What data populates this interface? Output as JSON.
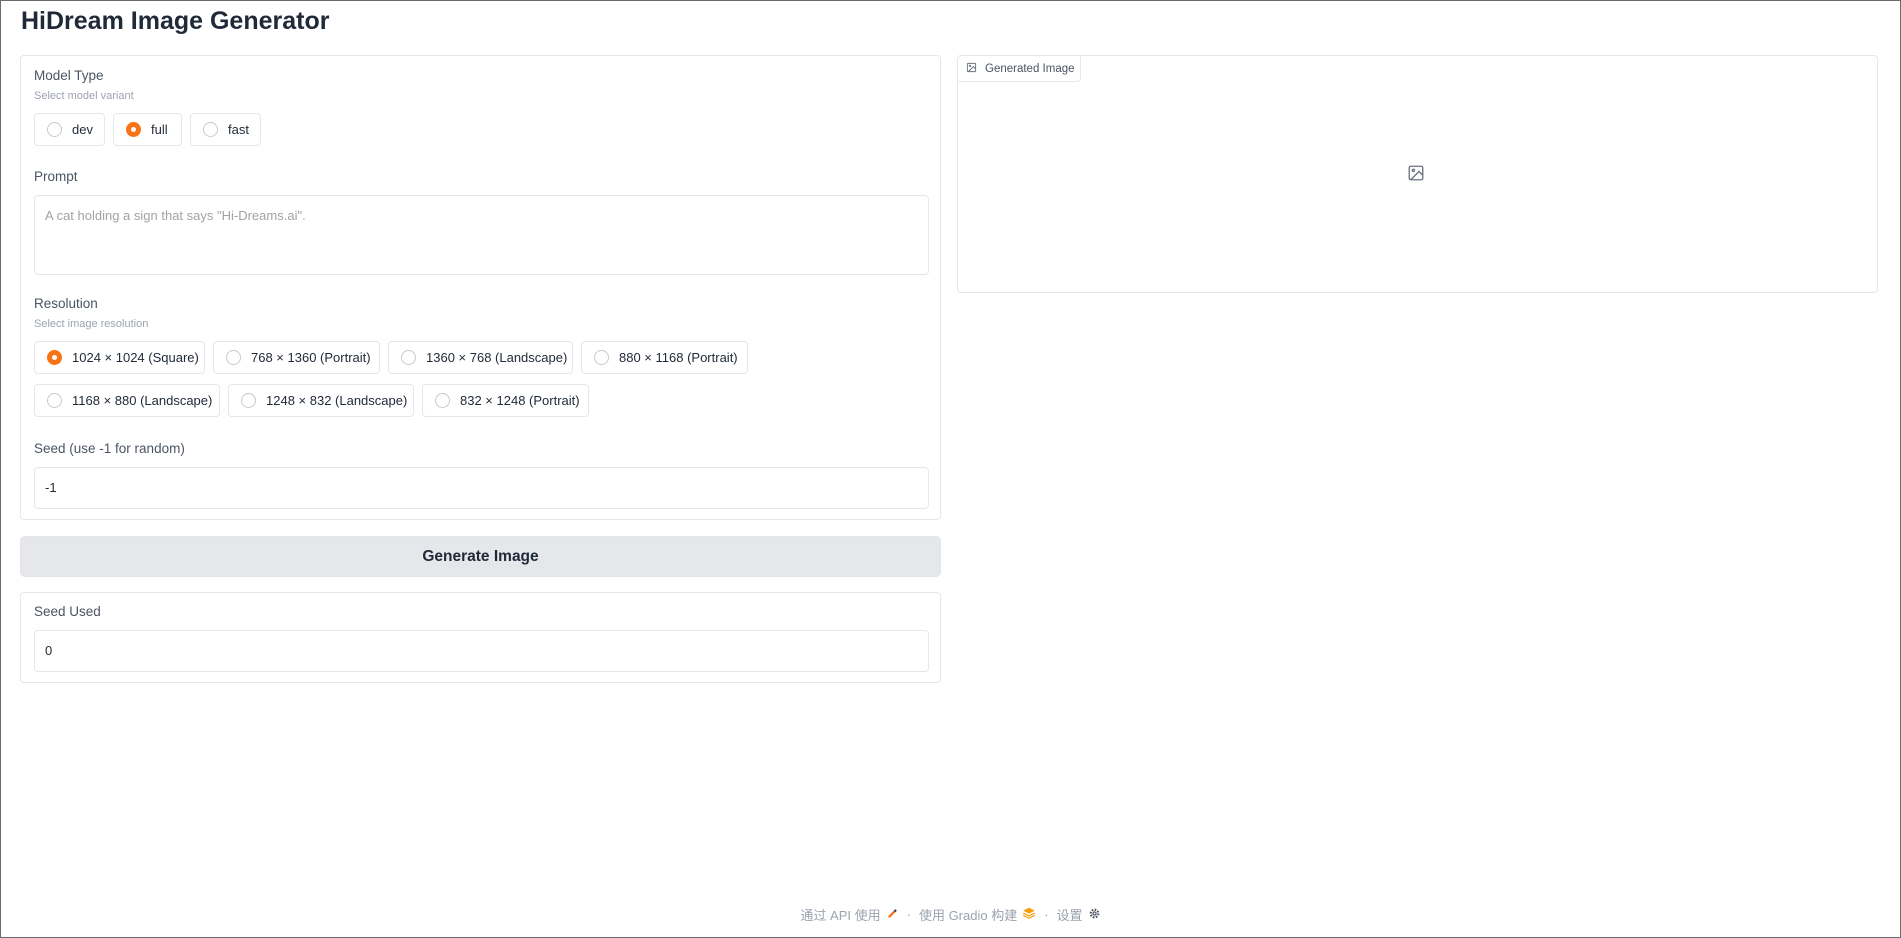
{
  "app": {
    "title": "HiDream Image Generator"
  },
  "model": {
    "label": "Model Type",
    "sublabel": "Select model variant",
    "options": [
      {
        "label": "dev",
        "selected": false
      },
      {
        "label": "full",
        "selected": true
      },
      {
        "label": "fast",
        "selected": false
      }
    ]
  },
  "prompt": {
    "label": "Prompt",
    "placeholder": "A cat holding a sign that says \"Hi-Dreams.ai\"."
  },
  "resolution": {
    "label": "Resolution",
    "sublabel": "Select image resolution",
    "options": [
      {
        "label": "1024 × 1024 (Square)",
        "selected": true
      },
      {
        "label": "768 × 1360 (Portrait)",
        "selected": false
      },
      {
        "label": "1360 × 768 (Landscape)",
        "selected": false
      },
      {
        "label": "880 × 1168 (Portrait)",
        "selected": false
      },
      {
        "label": "1168 × 880 (Landscape)",
        "selected": false
      },
      {
        "label": "1248 × 832 (Landscape)",
        "selected": false
      },
      {
        "label": "832 × 1248 (Portrait)",
        "selected": false
      }
    ]
  },
  "seed": {
    "label": "Seed (use -1 for random)",
    "value": "-1"
  },
  "generate": {
    "label": "Generate Image"
  },
  "seed_used": {
    "label": "Seed Used",
    "value": "0"
  },
  "output": {
    "tab_label": "Generated Image"
  },
  "footer": {
    "api_label": "通过 API 使用",
    "built_label": "使用 Gradio 构建",
    "settings_label": "设置",
    "separator": "·"
  },
  "colors": {
    "accent": "#f97316",
    "button_bg": "#e5e7eb",
    "border": "#e5e7eb"
  }
}
